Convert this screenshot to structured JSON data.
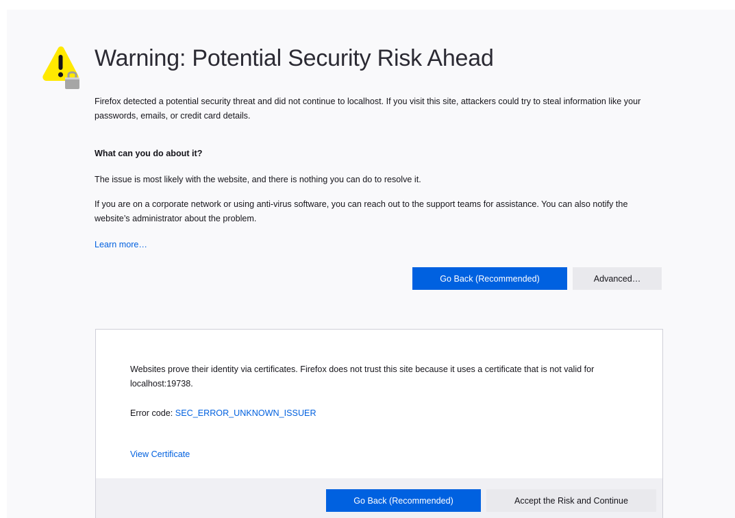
{
  "error_page": {
    "title": "Warning: Potential Security Risk Ahead",
    "intro": "Firefox detected a potential security threat and did not continue to localhost. If you visit this site, attackers could try to steal information like your passwords, emails, or credit card details.",
    "what_heading": "What can you do about it?",
    "issue_text": "The issue is most likely with the website, and there is nothing you can do to resolve it.",
    "corporate_text": "If you are on a corporate network or using anti-virus software, you can reach out to the support teams for assistance. You can also notify the website’s administrator about the problem.",
    "learn_more": "Learn more…",
    "go_back_label": "Go Back (Recommended)",
    "advanced_label": "Advanced…",
    "icon": "warning-lock-icon"
  },
  "advanced_panel": {
    "cert_text": "Websites prove their identity via certificates. Firefox does not trust this site because it uses a certificate that is not valid for localhost:19738.",
    "error_code_label": "Error code:",
    "error_code": "SEC_ERROR_UNKNOWN_ISSUER",
    "view_certificate": "View Certificate",
    "go_back_label": "Go Back (Recommended)",
    "accept_label": "Accept the Risk and Continue"
  },
  "colors": {
    "primary_button": "#0061e0",
    "link": "#0060df",
    "warning_yellow": "#ffe900",
    "lock_gray": "#9e9e9e"
  }
}
